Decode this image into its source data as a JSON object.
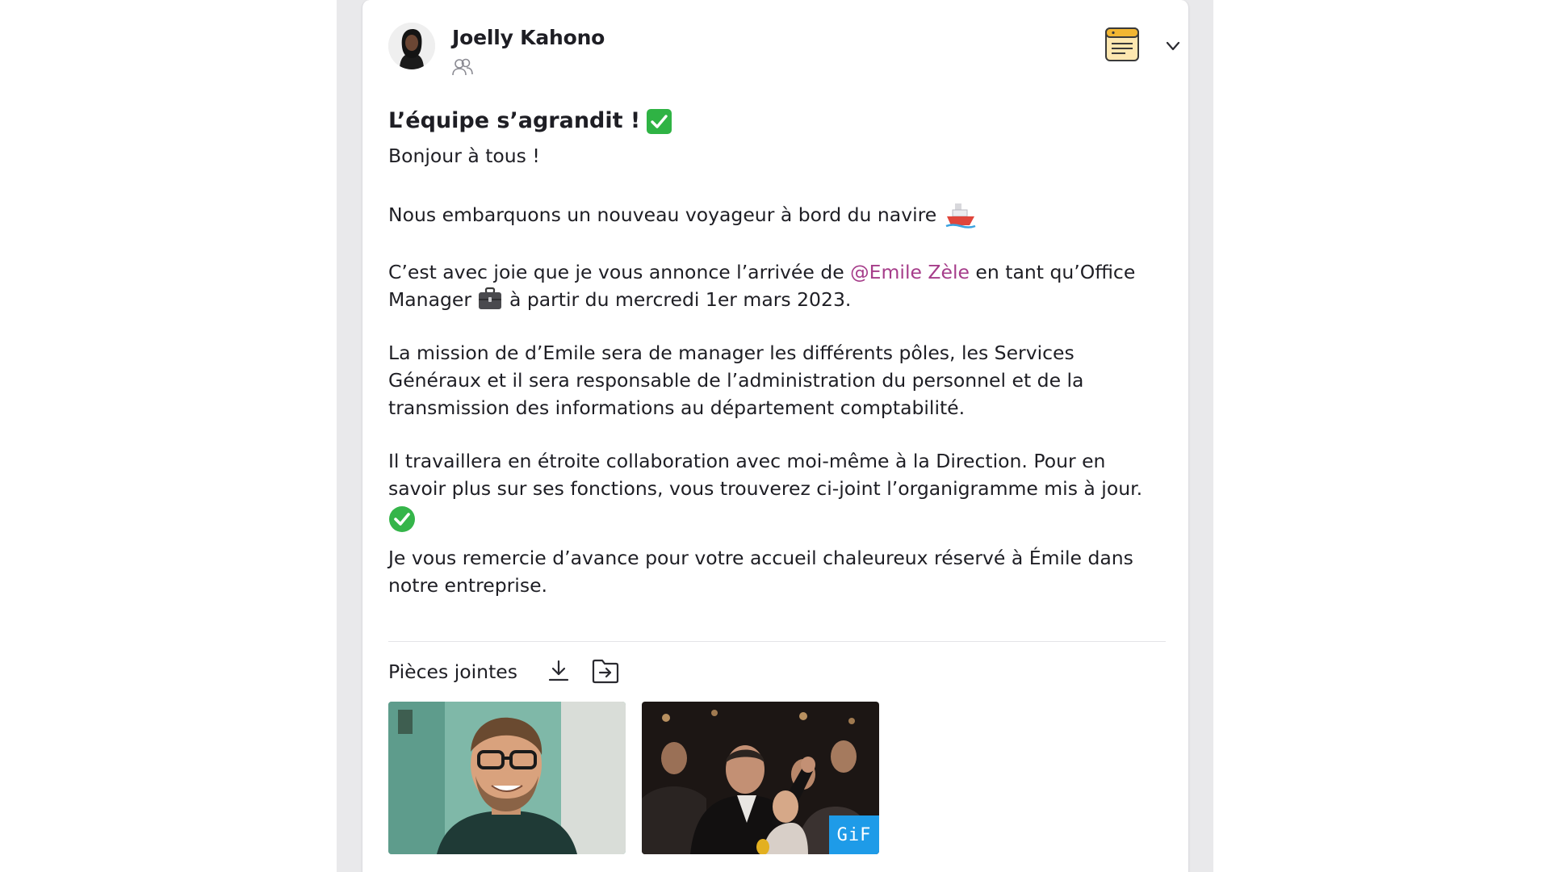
{
  "post": {
    "author": {
      "name": "Joelly Kahono",
      "avatar_icon": "user-avatar",
      "audience_icon": "group-icon"
    },
    "header_actions": {
      "document_icon": "document-list-icon",
      "menu_icon": "chevron-down-icon"
    },
    "title": "L’équipe s’agrandit !",
    "greeting": "Bonjour à tous !",
    "boarding": "Nous embarquons un nouveau voyageur à bord du navire",
    "welcome_before": "C’est avec joie que je vous annonce l’arrivée de ",
    "mention": "@Emile Zèle",
    "welcome_middle": " en tant qu’Office Manager ",
    "welcome_after": " à partir du mercredi 1er mars 2023.",
    "mission": "La mission de d’Emile sera de manager les différents pôles, les Services Généraux et il sera responsable de l’administration du personnel et de la transmission des informations au département comptabilité.",
    "collaboration": "Il travaillera en étroite collaboration avec moi-même à la Direction. Pour en savoir plus sur ses fonctions, vous trouverez ci-joint l’organigramme mis à jour.",
    "thanks": "Je vous remercie d’avance pour votre accueil chaleureux réservé à Émile dans notre entreprise."
  },
  "attachments": {
    "label": "Pièces jointes",
    "download_icon": "download-icon",
    "move_icon": "move-to-folder-icon",
    "items": [
      {
        "type": "photo"
      },
      {
        "type": "gif",
        "badge": "GiF"
      }
    ]
  },
  "colors": {
    "mention": "#a63d8a",
    "check_green": "#2fb344",
    "gif_badge": "#1e9be8",
    "doc_icon_accent": "#f2b632"
  }
}
